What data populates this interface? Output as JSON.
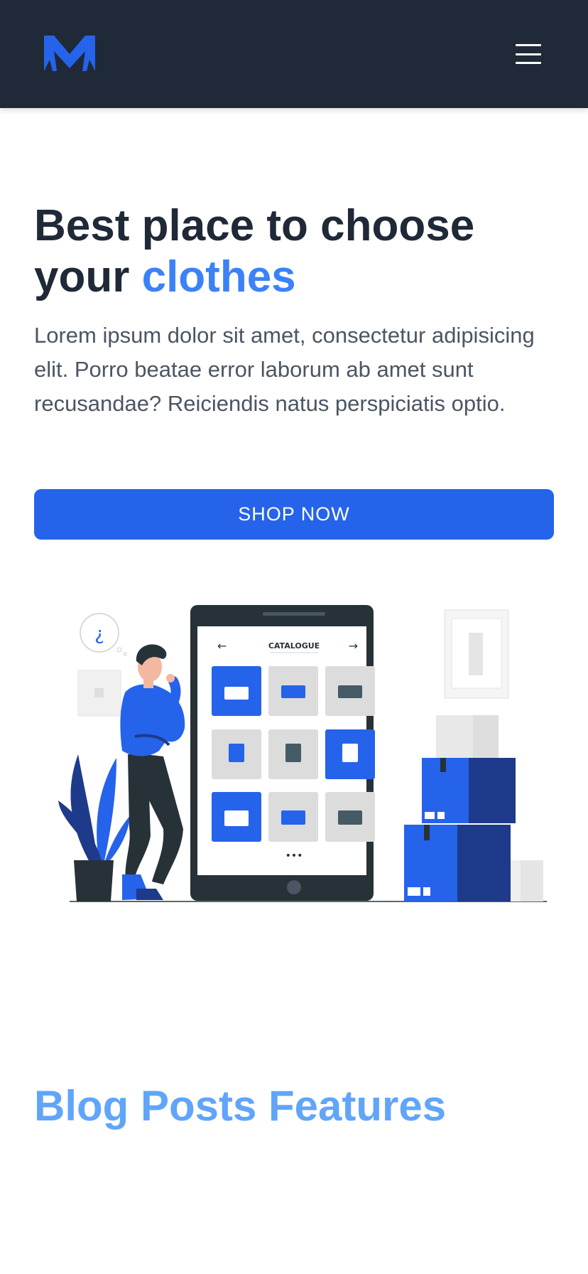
{
  "header": {
    "logo_icon": "brand-m-logo",
    "menu_icon": "hamburger-menu-icon"
  },
  "hero": {
    "title_line1": "Best place to choose",
    "title_word": "your",
    "title_highlight": "clothes",
    "description": "Lorem ipsum dolor sit amet, consectetur adipisicing elit. Porro beatae error laborum ab amet sunt recusandae? Reiciendis natus perspiciatis optio.",
    "button_label": "SHOP NOW"
  },
  "illustration": {
    "catalogue_label": "CATALOGUE",
    "thought_symbol": "¿",
    "dots": "•••",
    "prev_icon": "arrow-left-icon",
    "next_icon": "arrow-right-icon"
  },
  "blog": {
    "title": "Blog Posts Features"
  },
  "colors": {
    "header_bg": "#1f2937",
    "brand_blue": "#2563eb",
    "accent_blue": "#3b82f6",
    "blog_title": "#60a5fa",
    "text_dark": "#1f2937",
    "text_muted": "#4b5563"
  }
}
